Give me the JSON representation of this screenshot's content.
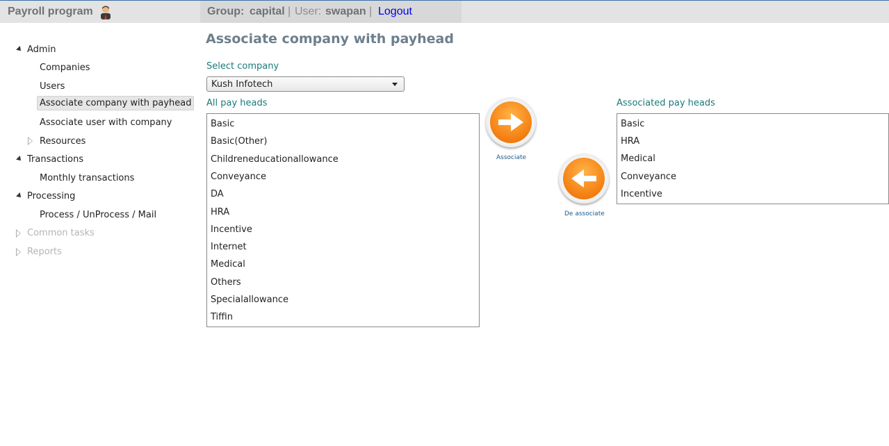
{
  "header": {
    "app_title": "Payroll program",
    "app_icon": "user-avatar-icon",
    "group_label": "Group:",
    "group_value": "capital",
    "separator": "|",
    "user_label": "User:",
    "user_value": "swapan",
    "logout_label": "Logout"
  },
  "sidebar": {
    "admin": "Admin",
    "companies": "Companies",
    "users": "Users",
    "associate_company_payhead": "Associate company with payhead",
    "associate_user_company": "Associate user with company",
    "resources": "Resources",
    "transactions": "Transactions",
    "monthly_transactions": "Monthly transactions",
    "processing": "Processing",
    "process_unprocess_mail": "Process / UnProcess / Mail",
    "common_tasks": "Common tasks",
    "reports": "Reports"
  },
  "main": {
    "title": "Associate company with payhead",
    "select_company_label": "Select company",
    "selected_company": "Kush Infotech",
    "all_pay_heads_label": "All pay heads",
    "associated_pay_heads_label": "Associated pay heads",
    "all_pay_heads": [
      "Basic",
      "Basic(Other)",
      "Childreneducationallowance",
      "Conveyance",
      "DA",
      "HRA",
      "Incentive",
      "Internet",
      "Medical",
      "Others",
      "Specialallowance",
      "Tiffin"
    ],
    "associated_pay_heads": [
      "Basic",
      "HRA",
      "Medical",
      "Conveyance",
      "Incentive"
    ],
    "associate_label": "Associate",
    "deassociate_label": "De associate"
  },
  "colors": {
    "accent_teal": "#1a7a7a",
    "button_orange": "#f7891b",
    "title_gray": "#6d7f8c"
  }
}
